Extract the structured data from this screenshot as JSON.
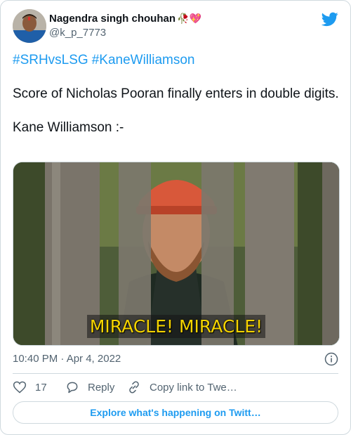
{
  "author": {
    "display_name": "Nagendra singh chouhan",
    "emoji": "🥀💖",
    "handle": "@k_p_7773"
  },
  "tweet": {
    "hashtags": [
      "#SRHvsLSG",
      "#KaneWilliamson"
    ],
    "line1": "Score of Nicholas Pooran finally enters in double digits.",
    "line2": "Kane Williamson :-"
  },
  "media": {
    "caption": "MIRACLE! MIRACLE!"
  },
  "meta": {
    "timestamp": "10:40 PM · Apr 4, 2022"
  },
  "actions": {
    "like_count": "17",
    "reply_label": "Reply",
    "copy_label": "Copy link to Twe…"
  },
  "footer": {
    "explore_label": "Explore what's happening on Twitt…"
  },
  "colors": {
    "accent": "#1d9bf0",
    "text": "#0f1419",
    "muted": "#536471",
    "border": "#cfd9de",
    "caption": "#f5d400"
  }
}
